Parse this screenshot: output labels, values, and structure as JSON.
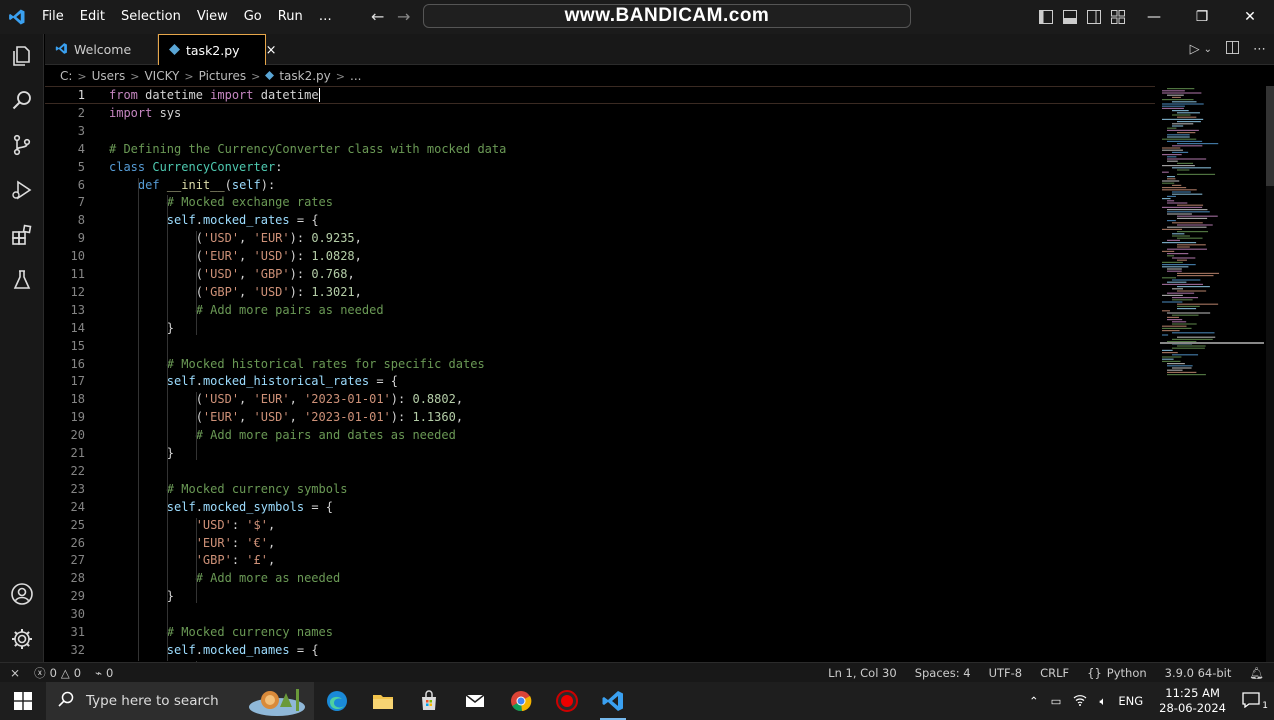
{
  "titlebar": {
    "menu": [
      "File",
      "Edit",
      "Selection",
      "View",
      "Go",
      "Run",
      "…"
    ],
    "watermark": "www.BANDICAM.com"
  },
  "tabs": [
    {
      "label": "Welcome"
    },
    {
      "label": "task2.py",
      "close": "×"
    }
  ],
  "breadcrumb": [
    "C:",
    "Users",
    "VICKY",
    "Pictures",
    "task2.py",
    "..."
  ],
  "editor": {
    "lines": [
      {
        "n": "1",
        "html": "<span class=\"kw\">from</span> datetime <span class=\"kw\">import</span> datetime"
      },
      {
        "n": "2",
        "html": "<span class=\"kw\">import</span> sys"
      },
      {
        "n": "3",
        "html": ""
      },
      {
        "n": "4",
        "html": "<span class=\"cmt\"># Defining the CurrencyConverter class with mocked data</span>"
      },
      {
        "n": "5",
        "html": "<span class=\"kwb\">class</span> <span class=\"cls\">CurrencyConverter</span>:"
      },
      {
        "n": "6",
        "html": "    <span class=\"kwb\">def</span> <span class=\"fn\">__init__</span>(<span class=\"var\">self</span>):"
      },
      {
        "n": "7",
        "html": "        <span class=\"cmt\"># Mocked exchange rates</span>"
      },
      {
        "n": "8",
        "html": "        <span class=\"var\">self</span>.<span class=\"var\">mocked_rates</span> = {"
      },
      {
        "n": "9",
        "html": "            (<span class=\"str\">'USD'</span>, <span class=\"str\">'EUR'</span>): <span class=\"num\">0.9235</span>,"
      },
      {
        "n": "10",
        "html": "            (<span class=\"str\">'EUR'</span>, <span class=\"str\">'USD'</span>): <span class=\"num\">1.0828</span>,"
      },
      {
        "n": "11",
        "html": "            (<span class=\"str\">'USD'</span>, <span class=\"str\">'GBP'</span>): <span class=\"num\">0.768</span>,"
      },
      {
        "n": "12",
        "html": "            (<span class=\"str\">'GBP'</span>, <span class=\"str\">'USD'</span>): <span class=\"num\">1.3021</span>,"
      },
      {
        "n": "13",
        "html": "            <span class=\"cmt\"># Add more pairs as needed</span>"
      },
      {
        "n": "14",
        "html": "        }"
      },
      {
        "n": "15",
        "html": ""
      },
      {
        "n": "16",
        "html": "        <span class=\"cmt\"># Mocked historical rates for specific dates</span>"
      },
      {
        "n": "17",
        "html": "        <span class=\"var\">self</span>.<span class=\"var\">mocked_historical_rates</span> = {"
      },
      {
        "n": "18",
        "html": "            (<span class=\"str\">'USD'</span>, <span class=\"str\">'EUR'</span>, <span class=\"str\">'2023-01-01'</span>): <span class=\"num\">0.8802</span>,"
      },
      {
        "n": "19",
        "html": "            (<span class=\"str\">'EUR'</span>, <span class=\"str\">'USD'</span>, <span class=\"str\">'2023-01-01'</span>): <span class=\"num\">1.1360</span>,"
      },
      {
        "n": "20",
        "html": "            <span class=\"cmt\"># Add more pairs and dates as needed</span>"
      },
      {
        "n": "21",
        "html": "        }"
      },
      {
        "n": "22",
        "html": ""
      },
      {
        "n": "23",
        "html": "        <span class=\"cmt\"># Mocked currency symbols</span>"
      },
      {
        "n": "24",
        "html": "        <span class=\"var\">self</span>.<span class=\"var\">mocked_symbols</span> = {"
      },
      {
        "n": "25",
        "html": "            <span class=\"str\">'USD'</span>: <span class=\"str\">'$'</span>,"
      },
      {
        "n": "26",
        "html": "            <span class=\"str\">'EUR'</span>: <span class=\"str\">'€'</span>,"
      },
      {
        "n": "27",
        "html": "            <span class=\"str\">'GBP'</span>: <span class=\"str\">'£'</span>,"
      },
      {
        "n": "28",
        "html": "            <span class=\"cmt\"># Add more as needed</span>"
      },
      {
        "n": "29",
        "html": "        }"
      },
      {
        "n": "30",
        "html": ""
      },
      {
        "n": "31",
        "html": "        <span class=\"cmt\"># Mocked currency names</span>"
      },
      {
        "n": "32",
        "html": "        <span class=\"var\">self</span>.<span class=\"var\">mocked_names</span> = {"
      }
    ],
    "current_line": 1
  },
  "statusbar": {
    "errors": "0",
    "warnings": "0",
    "ports": "0",
    "position": "Ln 1, Col 30",
    "spaces": "Spaces: 4",
    "encoding": "UTF-8",
    "eol": "CRLF",
    "language": "Python",
    "interpreter": "3.9.0 64-bit"
  },
  "taskbar": {
    "search_placeholder": "Type here to search",
    "language": "ENG",
    "time": "11:25 AM",
    "date": "28-06-2024",
    "notification_count": "1"
  },
  "colors": {
    "accent": "#e6a64a",
    "keyword": "#c586c0",
    "string": "#ce9178",
    "comment": "#6a9955",
    "number": "#b5cea8"
  }
}
